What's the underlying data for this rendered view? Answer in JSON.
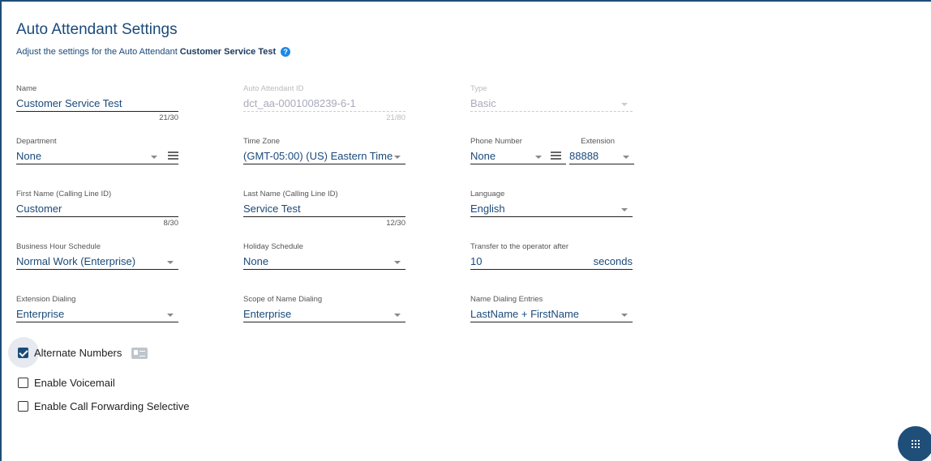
{
  "header": {
    "title": "Auto Attendant Settings",
    "subtitle_prefix": "Adjust the settings for the Auto Attendant",
    "subtitle_name": "Customer Service Test",
    "help_glyph": "?"
  },
  "fields": {
    "name": {
      "label": "Name",
      "value": "Customer Service Test",
      "counter": "21/30"
    },
    "aa_id": {
      "label": "Auto Attendant ID",
      "value": "dct_aa-0001008239-6-1",
      "counter": "21/80"
    },
    "type": {
      "label": "Type",
      "value": "Basic"
    },
    "department": {
      "label": "Department",
      "value": "None"
    },
    "time_zone": {
      "label": "Time Zone",
      "value": "(GMT-05:00) (US) Eastern Time"
    },
    "phone_number": {
      "label": "Phone Number",
      "value": "None"
    },
    "extension": {
      "label": "Extension",
      "value": "88888"
    },
    "first_name": {
      "label": "First Name (Calling Line ID)",
      "value": "Customer",
      "counter": "8/30"
    },
    "last_name": {
      "label": "Last Name (Calling Line ID)",
      "value": "Service Test",
      "counter": "12/30"
    },
    "language": {
      "label": "Language",
      "value": "English"
    },
    "business_hours": {
      "label": "Business Hour Schedule",
      "value": "Normal Work (Enterprise)"
    },
    "holiday": {
      "label": "Holiday Schedule",
      "value": "None"
    },
    "transfer": {
      "label": "Transfer to the operator after",
      "value": "10",
      "suffix": "seconds"
    },
    "ext_dialing": {
      "label": "Extension Dialing",
      "value": "Enterprise"
    },
    "scope_name": {
      "label": "Scope of Name Dialing",
      "value": "Enterprise"
    },
    "name_entries": {
      "label": "Name Dialing Entries",
      "value": "LastName + FirstName"
    }
  },
  "checkboxes": {
    "alternate_numbers": {
      "label": "Alternate Numbers",
      "checked": true
    },
    "voicemail": {
      "label": "Enable Voicemail",
      "checked": false
    },
    "call_forwarding": {
      "label": "Enable Call Forwarding Selective",
      "checked": false
    }
  },
  "colors": {
    "accent": "#1f4e79",
    "text": "#1a4a7a",
    "help": "#1e88e5"
  }
}
